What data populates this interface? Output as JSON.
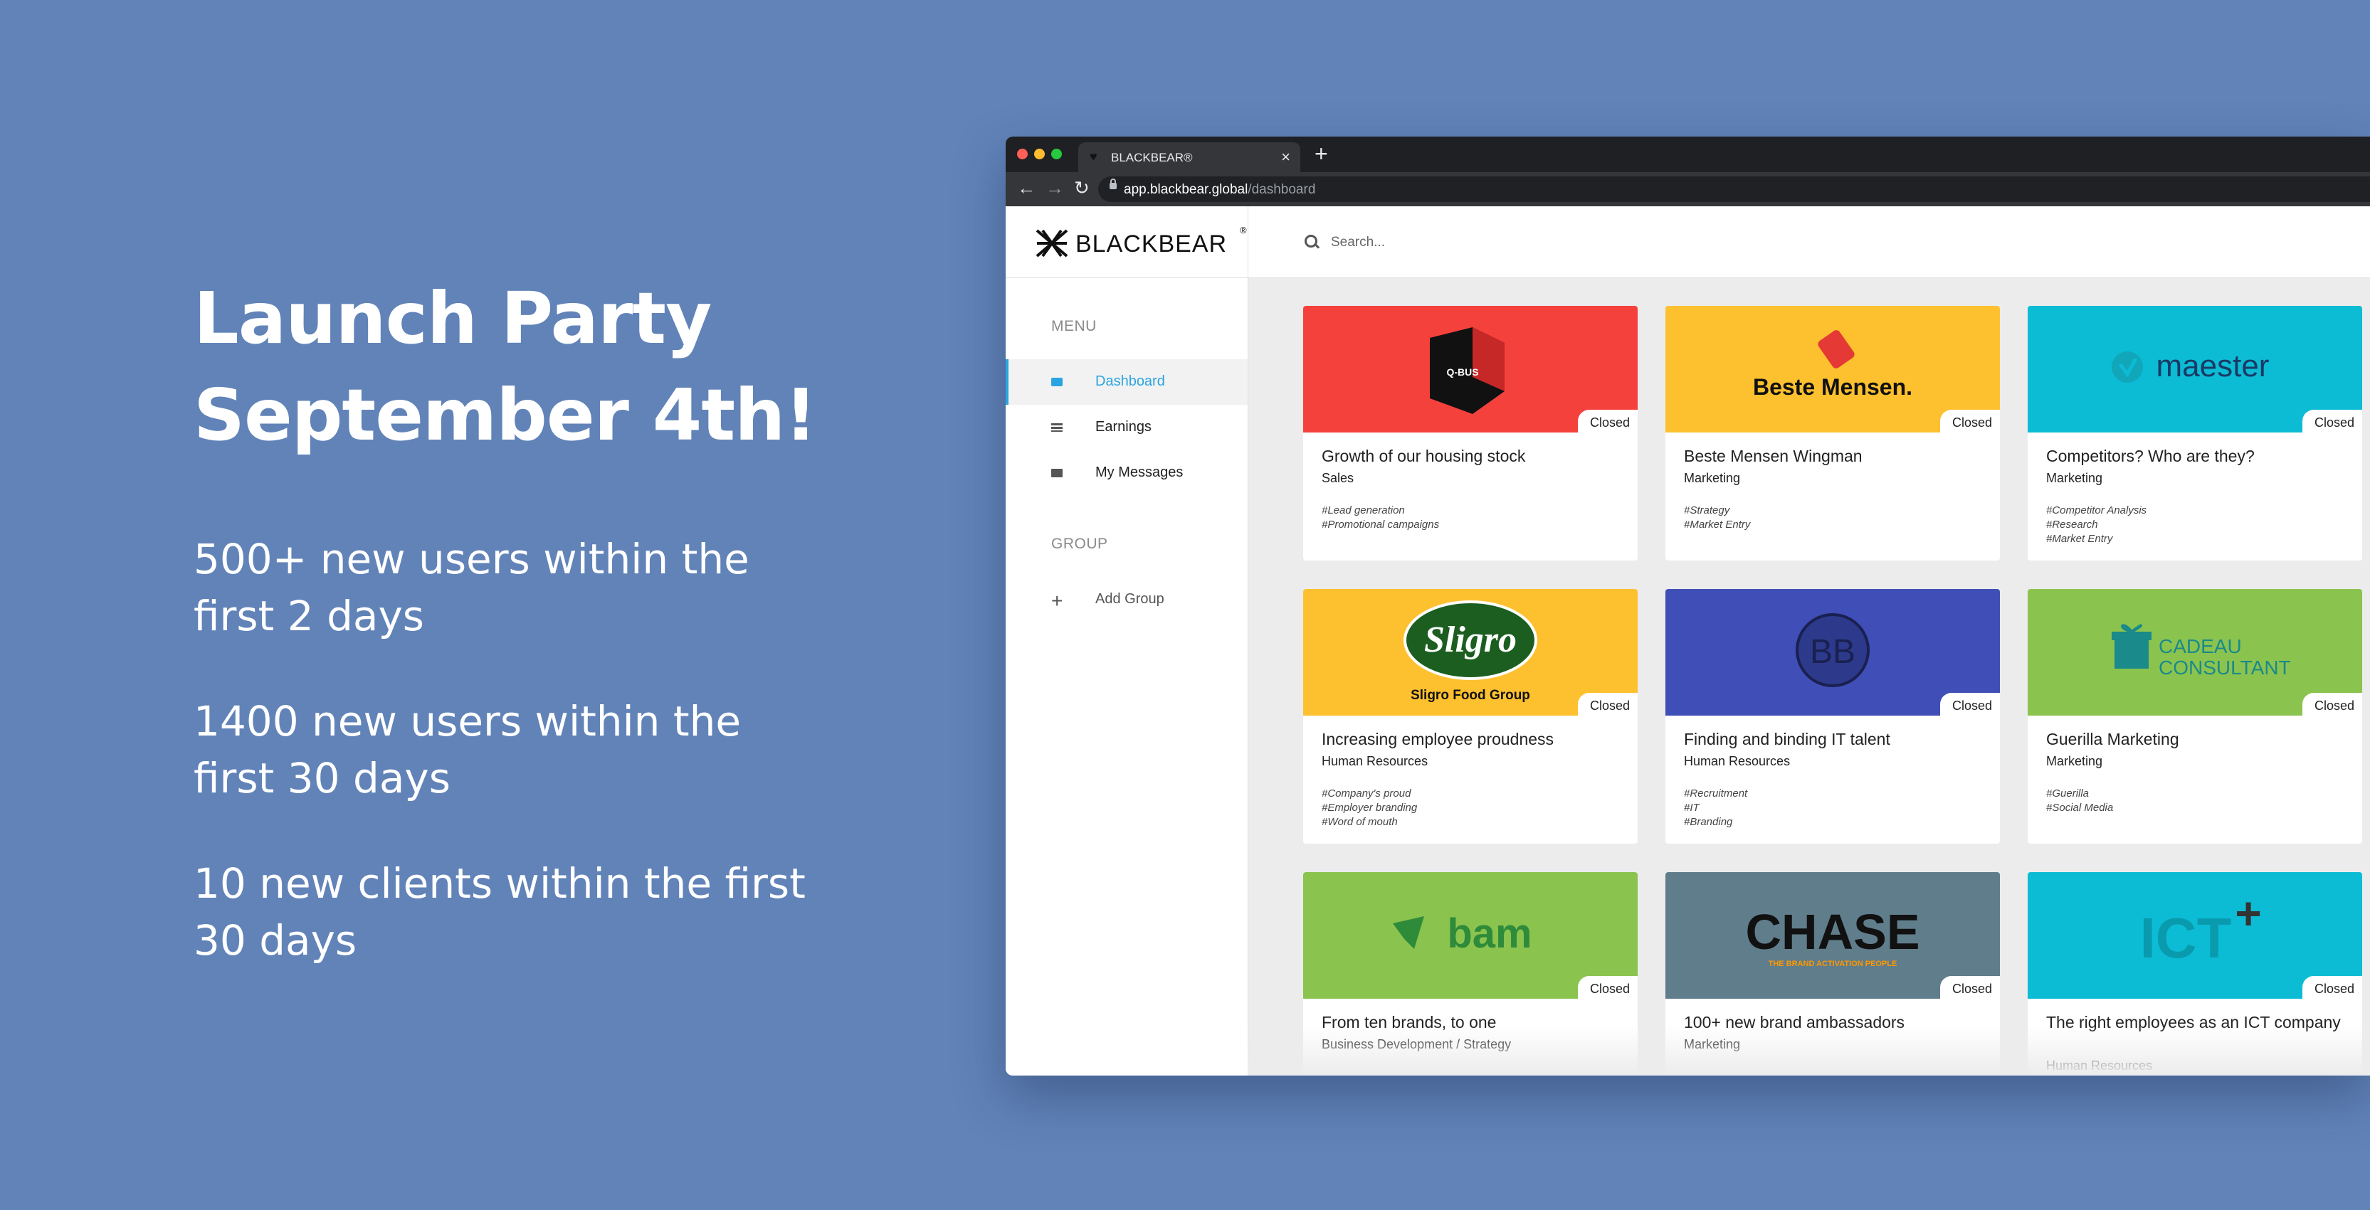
{
  "hero": {
    "title": "Launch Party September 4th!",
    "stats": [
      "500+ new users within the first 2 days",
      "1400 new users within the first 30 days",
      "10 new clients within the first 30 days"
    ]
  },
  "browser": {
    "tab_title": "BLACKBEAR®",
    "tab_close": "×",
    "new_tab": "+",
    "back": "←",
    "forward": "→",
    "reload": "↻",
    "url_host": "app.blackbear.global",
    "url_path": "/dashboard"
  },
  "app": {
    "logo_text": "BLACKBEAR",
    "logo_reg": "®",
    "search_placeholder": "Search...",
    "menu_heading": "MENU",
    "menu_items": [
      {
        "label": "Dashboard",
        "icon": "briefcase-icon",
        "active": true
      },
      {
        "label": "Earnings",
        "icon": "stack-icon",
        "active": false
      },
      {
        "label": "My Messages",
        "icon": "envelope-icon",
        "active": false
      }
    ],
    "group_heading": "GROUP",
    "add_group_icon": "+",
    "add_group_label": "Add Group"
  },
  "cards": [
    {
      "title": "Growth of our housing stock",
      "category": "Sales",
      "tags": [
        "#Lead generation",
        "#Promotional campaigns"
      ],
      "status": "Closed",
      "color": "#f5413c",
      "brand": "Q-BUS"
    },
    {
      "title": "Beste Mensen Wingman",
      "category": "Marketing",
      "tags": [
        "#Strategy",
        "#Market Entry"
      ],
      "status": "Closed",
      "color": "#fdc02f",
      "brand": "Beste Mensen."
    },
    {
      "title": "Competitors? Who are they?",
      "category": "Marketing",
      "tags": [
        "#Competitor Analysis",
        "#Research",
        "#Market Entry"
      ],
      "status": "Closed",
      "color": "#0bbcd4",
      "brand": "maester"
    },
    {
      "title": "Increasing employee proudness",
      "category": "Human Resources",
      "tags": [
        "#Company's proud",
        "#Employer branding",
        "#Word of mouth"
      ],
      "status": "Closed",
      "color": "#fdc02f",
      "brand": "Sligro",
      "brand_sub": "Sligro Food Group"
    },
    {
      "title": "Finding and binding IT talent",
      "category": "Human Resources",
      "tags": [
        "#Recruitment",
        "#IT",
        "#Branding"
      ],
      "status": "Closed",
      "color": "#3f4fb7",
      "brand": "BB"
    },
    {
      "title": "Guerilla Marketing",
      "category": "Marketing",
      "tags": [
        "#Guerilla",
        "#Social Media"
      ],
      "status": "Closed",
      "color": "#8bc34f",
      "brand": "CADEAU",
      "brand_sub": "CONSULTANT"
    },
    {
      "title": "From ten brands, to one",
      "category": "Business Development / Strategy",
      "tags": [],
      "status": "Closed",
      "color": "#8bc34f",
      "brand": "bam"
    },
    {
      "title": "100+ new brand ambassadors",
      "category": "Marketing",
      "tags": [],
      "status": "Closed",
      "color": "#607d8b",
      "brand": "CHASE",
      "brand_sub": "THE BRAND ACTIVATION PEOPLE"
    },
    {
      "title": "The right employees as an ICT company",
      "category": "Human Resources",
      "tags": [],
      "status": "Closed",
      "color": "#0bbcd4",
      "brand": "ICT",
      "brand_mark": "+"
    }
  ]
}
